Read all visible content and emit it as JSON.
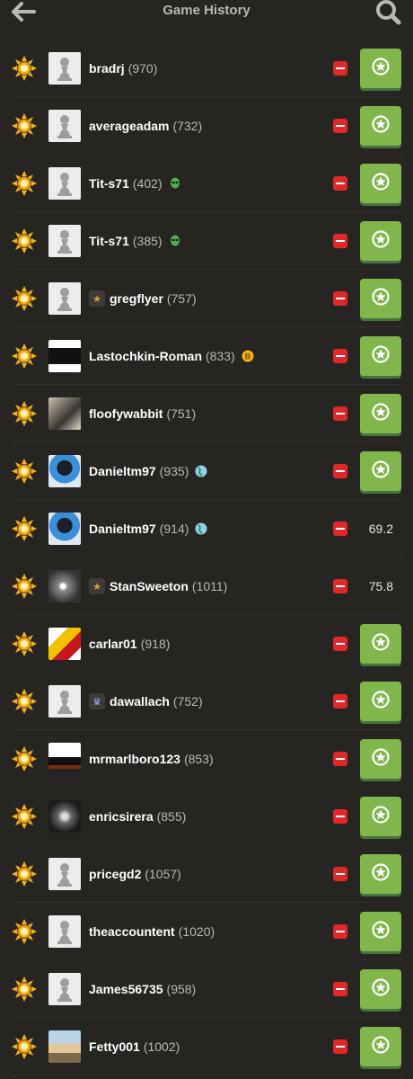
{
  "header": {
    "title": "Game History"
  },
  "colors": {
    "background": "#262522",
    "review_green": "#81b64c",
    "loss_red": "#e02828",
    "sun_yellow": "#f2b21c"
  },
  "games": [
    {
      "username": "bradrj",
      "rating": "(970)",
      "badge": null,
      "flag": null,
      "avatar": "pawn",
      "result": "minus",
      "accuracy": null
    },
    {
      "username": "averageadam",
      "rating": "(732)",
      "badge": null,
      "flag": null,
      "avatar": "pawn",
      "result": "minus",
      "accuracy": null
    },
    {
      "username": "Tit-s71",
      "rating": "(402)",
      "badge": null,
      "flag": "alien",
      "avatar": "pawn",
      "result": "minus",
      "accuracy": null
    },
    {
      "username": "Tit-s71",
      "rating": "(385)",
      "badge": null,
      "flag": "alien",
      "avatar": "pawn",
      "result": "minus",
      "accuracy": null
    },
    {
      "username": "gregflyer",
      "rating": "(757)",
      "badge": "star",
      "flag": null,
      "avatar": "pawn",
      "result": "minus",
      "accuracy": null
    },
    {
      "username": "Lastochkin-Roman",
      "rating": "(833)",
      "badge": null,
      "flag": "coin",
      "avatar": "photo-dark",
      "result": "minus",
      "accuracy": null
    },
    {
      "username": "floofywabbit",
      "rating": "(751)",
      "badge": null,
      "flag": null,
      "avatar": "photo-cat",
      "result": "minus",
      "accuracy": null
    },
    {
      "username": "Danieltm97",
      "rating": "(935)",
      "badge": null,
      "flag": "globe",
      "avatar": "photo-person",
      "result": "minus",
      "accuracy": null
    },
    {
      "username": "Danieltm97",
      "rating": "(914)",
      "badge": null,
      "flag": "globe",
      "avatar": "photo-person",
      "result": "minus",
      "accuracy": "69.2"
    },
    {
      "username": "StanSweeton",
      "rating": "(1011)",
      "badge": "star",
      "flag": null,
      "avatar": "photo-light",
      "result": "minus",
      "accuracy": "75.8"
    },
    {
      "username": "carlar01",
      "rating": "(918)",
      "badge": null,
      "flag": null,
      "avatar": "photo-flag",
      "result": "minus",
      "accuracy": null
    },
    {
      "username": "dawallach",
      "rating": "(752)",
      "badge": "crown",
      "flag": null,
      "avatar": "pawn",
      "result": "minus",
      "accuracy": null
    },
    {
      "username": "mrmarlboro123",
      "rating": "(853)",
      "badge": null,
      "flag": null,
      "avatar": "photo-atari",
      "result": "minus",
      "accuracy": null
    },
    {
      "username": "enricsirera",
      "rating": "(855)",
      "badge": null,
      "flag": null,
      "avatar": "photo-ufo",
      "result": "minus",
      "accuracy": null
    },
    {
      "username": "pricegd2",
      "rating": "(1057)",
      "badge": null,
      "flag": null,
      "avatar": "pawn",
      "result": "minus",
      "accuracy": null
    },
    {
      "username": "theaccountent",
      "rating": "(1020)",
      "badge": null,
      "flag": null,
      "avatar": "pawn",
      "result": "minus",
      "accuracy": null
    },
    {
      "username": "James56735",
      "rating": "(958)",
      "badge": null,
      "flag": null,
      "avatar": "pawn",
      "result": "minus",
      "accuracy": null
    },
    {
      "username": "Fetty001",
      "rating": "(1002)",
      "badge": null,
      "flag": null,
      "avatar": "photo-outdoor",
      "result": "minus",
      "accuracy": null
    }
  ]
}
